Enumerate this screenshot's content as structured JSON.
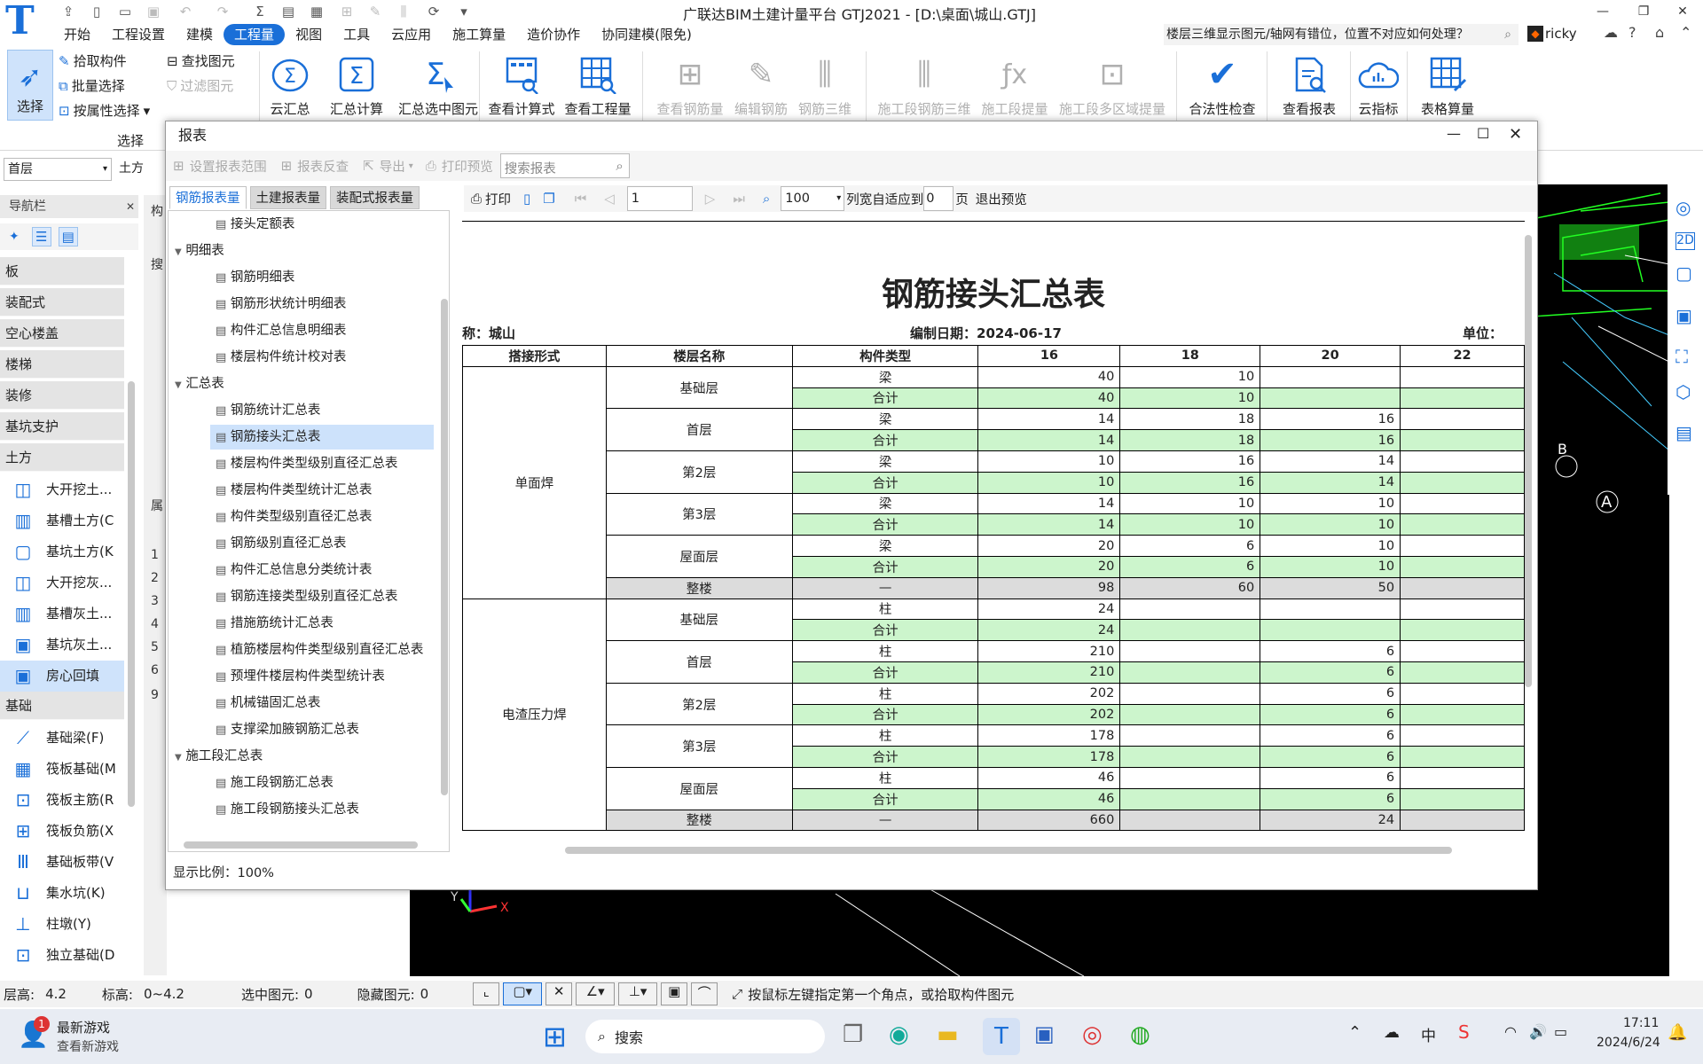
{
  "app": {
    "title": "广联达BIM土建计量平台 GTJ2021 - [D:\\桌面\\城山.GTJ]",
    "search_text": "楼层三维显示图元/轴网有错位，位置不对应如何处理？",
    "user": "ricky",
    "menu": [
      "开始",
      "工程设置",
      "建模",
      "工程量",
      "视图",
      "工具",
      "云应用",
      "施工算量",
      "造价协作",
      "协同建模(限免)"
    ],
    "active_menu": "工程量"
  },
  "ribbon": {
    "select_label": "选择",
    "pick_component": "拾取构件",
    "batch_select": "批量选择",
    "prop_select": "按属性选择",
    "find_element": "查找图元",
    "filter_element": "过滤图元",
    "group_select": "选择",
    "cloud_summary": "云汇总",
    "summary_calc": "汇总计算",
    "summary_selected": "汇总选中图元",
    "view_formula": "查看计算式",
    "view_quantity": "查看工程量",
    "view_rebar": "查看钢筋量",
    "edit_rebar": "编辑钢筋",
    "rebar_3d": "钢筋三维",
    "stage_rebar_3d": "施工段钢筋三维",
    "stage_extract": "施工段提量",
    "stage_multi_extract": "施工段多区域提量",
    "validity_check": "合法性检查",
    "view_report": "查看报表",
    "cloud_index": "云指标",
    "table_calc": "表格算量"
  },
  "left": {
    "floor": "首层",
    "type": "土方",
    "nav_title": "导航栏",
    "categories_top": [
      "板",
      "装配式",
      "空心楼盖",
      "楼梯",
      "装修",
      "基坑支护",
      "土方"
    ],
    "tufang_items": [
      "大开挖土...",
      "基槽土方(C",
      "基坑土方(K",
      "大开挖灰...",
      "基槽灰土...",
      "基坑灰土...",
      "房心回填"
    ],
    "selected_item": "房心回填",
    "category_found": "基础",
    "found_items": [
      "基础梁(F)",
      "筏板基础(M",
      "筏板主筋(R",
      "筏板负筋(X",
      "基础板带(V",
      "集水坑(K)",
      "柱墩(Y)",
      "独立基础(D"
    ],
    "prop_labels": [
      "构",
      "搜",
      "属",
      "1",
      "2",
      "3",
      "4",
      "5",
      "6",
      "9"
    ]
  },
  "status": {
    "floor_height": "层高:",
    "floor_height_val": "4.2",
    "elevation": "标高:",
    "elevation_val": "0~4.2",
    "selected": "选中图元:",
    "selected_val": "0",
    "hidden": "隐藏图元:",
    "hidden_val": "0",
    "hint": "按鼠标左键指定第一个角点，或拾取构件图元"
  },
  "taskbar": {
    "game_title": "最新游戏",
    "game_sub": "查看新游戏",
    "badge": "1",
    "search": "搜索",
    "ime": "中",
    "time": "17:11",
    "date": "2024/6/24"
  },
  "dialog": {
    "title": "报表",
    "tools": [
      "设置报表范围",
      "报表反查",
      "导出",
      "打印预览"
    ],
    "search_placeholder": "搜索报表",
    "tabs": [
      "钢筋报表量",
      "土建报表量",
      "装配式报表量"
    ],
    "tree": [
      {
        "label": "接头定额表",
        "level": 2
      },
      {
        "label": "明细表",
        "level": 1
      },
      {
        "label": "钢筋明细表",
        "level": 2
      },
      {
        "label": "钢筋形状统计明细表",
        "level": 2
      },
      {
        "label": "构件汇总信息明细表",
        "level": 2
      },
      {
        "label": "楼层构件统计校对表",
        "level": 2
      },
      {
        "label": "汇总表",
        "level": 1
      },
      {
        "label": "钢筋统计汇总表",
        "level": 2
      },
      {
        "label": "钢筋接头汇总表",
        "level": 2,
        "selected": true
      },
      {
        "label": "楼层构件类型级别直径汇总表",
        "level": 2
      },
      {
        "label": "楼层构件类型统计汇总表",
        "level": 2
      },
      {
        "label": "构件类型级别直径汇总表",
        "level": 2
      },
      {
        "label": "钢筋级别直径汇总表",
        "level": 2
      },
      {
        "label": "构件汇总信息分类统计表",
        "level": 2
      },
      {
        "label": "钢筋连接类型级别直径汇总表",
        "level": 2
      },
      {
        "label": "措施筋统计汇总表",
        "level": 2
      },
      {
        "label": "植筋楼层构件类型级别直径汇总表",
        "level": 2
      },
      {
        "label": "预埋件楼层构件类型统计表",
        "level": 2
      },
      {
        "label": "机械锚固汇总表",
        "level": 2
      },
      {
        "label": "支撑梁加腋钢筋汇总表",
        "level": 2
      },
      {
        "label": "施工段汇总表",
        "level": 1
      },
      {
        "label": "施工段钢筋汇总表",
        "level": 2
      },
      {
        "label": "施工段钢筋接头汇总表",
        "level": 2
      }
    ],
    "preview": {
      "print": "打印",
      "page": "1",
      "zoom": "100",
      "fit_label": "列宽自适应到",
      "fit_val": "0",
      "page_unit": "页",
      "exit": "退出预览"
    },
    "zoom_text": "显示比例：100%"
  },
  "report": {
    "title": "钢筋接头汇总表",
    "project": "称：城山",
    "date": "编制日期：2024-06-17",
    "unit": "单位：",
    "headers": [
      "搭接形式",
      "楼层名称",
      "构件类型",
      "16",
      "18",
      "20",
      "22"
    ],
    "groups": [
      {
        "type": "单面焊",
        "floors": [
          {
            "name": "基础层",
            "comp": "梁",
            "vals": [
              "40",
              "10",
              "",
              ""
            ],
            "sum": [
              "40",
              "10",
              "",
              ""
            ]
          },
          {
            "name": "首层",
            "comp": "梁",
            "vals": [
              "14",
              "18",
              "16",
              ""
            ],
            "sum": [
              "14",
              "18",
              "16",
              ""
            ]
          },
          {
            "name": "第2层",
            "comp": "梁",
            "vals": [
              "10",
              "16",
              "14",
              ""
            ],
            "sum": [
              "10",
              "16",
              "14",
              ""
            ]
          },
          {
            "name": "第3层",
            "comp": "梁",
            "vals": [
              "14",
              "10",
              "10",
              ""
            ],
            "sum": [
              "14",
              "10",
              "10",
              ""
            ]
          },
          {
            "name": "屋面层",
            "comp": "梁",
            "vals": [
              "20",
              "6",
              "10",
              ""
            ],
            "sum": [
              "20",
              "6",
              "10",
              ""
            ]
          }
        ],
        "total_label": "整楼",
        "total_comp": "—",
        "total": [
          "98",
          "60",
          "50",
          ""
        ]
      },
      {
        "type": "电渣压力焊",
        "floors": [
          {
            "name": "基础层",
            "comp": "柱",
            "vals": [
              "24",
              "",
              "",
              ""
            ],
            "sum": [
              "24",
              "",
              "",
              ""
            ]
          },
          {
            "name": "首层",
            "comp": "柱",
            "vals": [
              "210",
              "",
              "6",
              ""
            ],
            "sum": [
              "210",
              "",
              "6",
              ""
            ]
          },
          {
            "name": "第2层",
            "comp": "柱",
            "vals": [
              "202",
              "",
              "6",
              ""
            ],
            "sum": [
              "202",
              "",
              "6",
              ""
            ]
          },
          {
            "name": "第3层",
            "comp": "柱",
            "vals": [
              "178",
              "",
              "6",
              ""
            ],
            "sum": [
              "178",
              "",
              "6",
              ""
            ]
          },
          {
            "name": "屋面层",
            "comp": "柱",
            "vals": [
              "46",
              "",
              "6",
              ""
            ],
            "sum": [
              "46",
              "",
              "6",
              ""
            ]
          }
        ],
        "total_label": "整楼",
        "total_comp": "—",
        "total": [
          "660",
          "",
          "24",
          ""
        ]
      }
    ],
    "sum_label": "合计"
  },
  "colors": {
    "accent": "#1a6fd8",
    "sum_row": "#ccf5cc",
    "total_row": "#dcdcdc",
    "cad_bg": "#000000"
  }
}
